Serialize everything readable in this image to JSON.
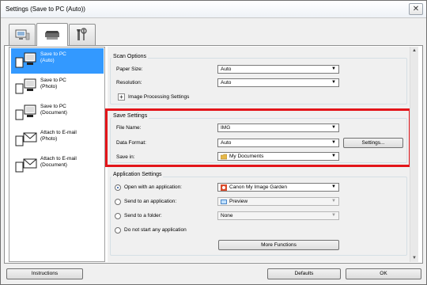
{
  "window": {
    "title": "Settings (Save to PC (Auto))",
    "close_glyph": "✕"
  },
  "tabs": [
    {
      "name": "scan-from-computer-tab",
      "icon": "computer-scan-icon"
    },
    {
      "name": "scan-from-operation-panel-tab",
      "icon": "scanner-icon"
    },
    {
      "name": "general-settings-tab",
      "icon": "tools-icon"
    }
  ],
  "sidebar": {
    "items": [
      {
        "label": "Save to PC\n(Auto)",
        "icon": "save-to-pc-icon",
        "selected": true
      },
      {
        "label": "Save to PC\n(Photo)",
        "icon": "save-to-pc-icon",
        "selected": false
      },
      {
        "label": "Save to PC\n(Document)",
        "icon": "save-to-pc-icon",
        "selected": false
      },
      {
        "label": "Attach to E-mail\n(Photo)",
        "icon": "email-icon",
        "selected": false
      },
      {
        "label": "Attach to E-mail\n(Document)",
        "icon": "email-icon",
        "selected": false
      }
    ]
  },
  "scan_options": {
    "title": "Scan Options",
    "paper_size_label": "Paper Size:",
    "paper_size_value": "Auto",
    "resolution_label": "Resolution:",
    "resolution_value": "Auto",
    "image_processing_label": "Image Processing Settings",
    "expand_glyph": "+"
  },
  "save_settings": {
    "title": "Save Settings",
    "file_name_label": "File Name:",
    "file_name_value": "IMG",
    "data_format_label": "Data Format:",
    "data_format_value": "Auto",
    "settings_button": "Settings...",
    "save_in_label": "Save in:",
    "save_in_value": "My Documents",
    "highlight_color": "#e3151a"
  },
  "application_settings": {
    "title": "Application Settings",
    "open_with_label": "Open with an application:",
    "open_with_value": "Canon My Image Garden",
    "send_to_app_label": "Send to an application:",
    "send_to_app_value": "Preview",
    "send_to_folder_label": "Send to a folder:",
    "send_to_folder_value": "None",
    "do_not_start_label": "Do not start any application",
    "more_functions_button": "More Functions"
  },
  "footer": {
    "instructions_button": "Instructions",
    "defaults_button": "Defaults",
    "ok_button": "OK"
  },
  "colors": {
    "selection": "#3399ff",
    "frame": "#8e8f8f",
    "panel_bg": "#f0f0f0"
  }
}
